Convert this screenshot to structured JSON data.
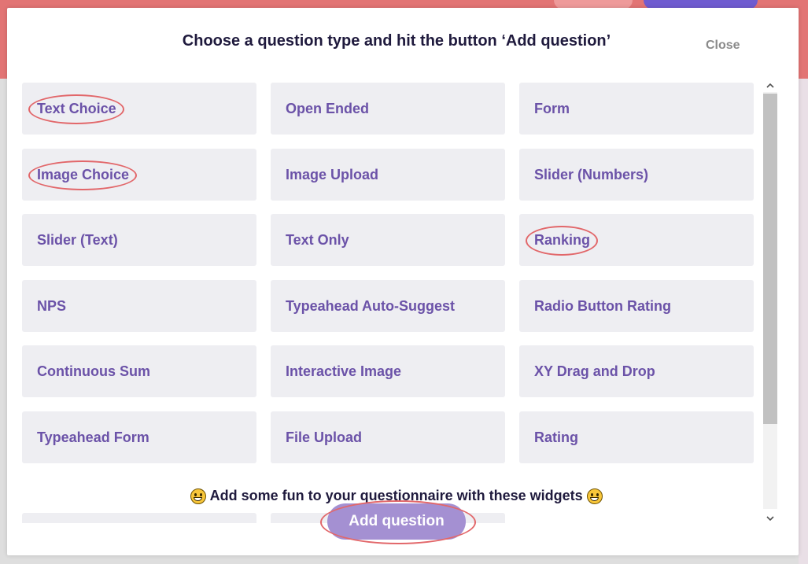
{
  "modal": {
    "title": "Choose a question type and hit the button ‘Add question’",
    "close_label": "Close",
    "fun_text": "Add some fun to your questionnaire with these widgets",
    "add_button_label": "Add question"
  },
  "question_types": [
    {
      "label": "Text Choice",
      "highlighted": true
    },
    {
      "label": "Open Ended",
      "highlighted": false
    },
    {
      "label": "Form",
      "highlighted": false
    },
    {
      "label": "Image Choice",
      "highlighted": true
    },
    {
      "label": "Image Upload",
      "highlighted": false
    },
    {
      "label": "Slider (Numbers)",
      "highlighted": false
    },
    {
      "label": "Slider (Text)",
      "highlighted": false
    },
    {
      "label": "Text Only",
      "highlighted": false
    },
    {
      "label": "Ranking",
      "highlighted": true
    },
    {
      "label": "NPS",
      "highlighted": false
    },
    {
      "label": "Typeahead Auto-Suggest",
      "highlighted": false
    },
    {
      "label": "Radio Button Rating",
      "highlighted": false
    },
    {
      "label": "Continuous Sum",
      "highlighted": false
    },
    {
      "label": "Interactive Image",
      "highlighted": false
    },
    {
      "label": "XY Drag and Drop",
      "highlighted": false
    },
    {
      "label": "Typeahead Form",
      "highlighted": false
    },
    {
      "label": "File Upload",
      "highlighted": false
    },
    {
      "label": "Rating",
      "highlighted": false
    }
  ],
  "colors": {
    "tile_bg": "#eeeef2",
    "tile_text": "#6b52a8",
    "highlight_ring": "#e2676a",
    "button_bg": "#a490d2"
  },
  "icons": {
    "emoji": "grinning-face-icon",
    "scroll_up": "chevron-up-icon",
    "scroll_down": "chevron-down-icon"
  }
}
